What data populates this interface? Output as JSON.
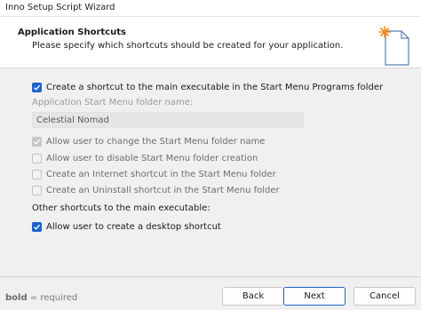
{
  "window": {
    "title": "Inno Setup Script Wizard"
  },
  "header": {
    "title": "Application Shortcuts",
    "subtitle": "Please specify which shortcuts should be created for your application.",
    "image_icon": "wizard-document-sparkle-icon"
  },
  "options": {
    "start_menu_shortcut": {
      "label": "Create a shortcut to the main executable in the Start Menu Programs folder",
      "checked": true
    },
    "folder_label": "Application Start Menu folder name:",
    "folder_value": "Celestial Nomad",
    "allow_change_folder": {
      "label": "Allow user to change the Start Menu folder name",
      "checked": true,
      "disabled": true
    },
    "allow_disable_folder": {
      "label": "Allow user to disable Start Menu folder creation",
      "checked": false,
      "disabled": true
    },
    "internet_shortcut": {
      "label": "Create an Internet shortcut in the Start Menu folder",
      "checked": false,
      "disabled": true
    },
    "uninstall_shortcut": {
      "label": "Create an Uninstall shortcut in the Start Menu folder",
      "checked": false,
      "disabled": true
    },
    "other_section_title": "Other shortcuts to the main executable:",
    "desktop_shortcut": {
      "label": "Allow user to create a desktop shortcut",
      "checked": true
    }
  },
  "footer": {
    "required_bold": "bold",
    "required_text": " = required",
    "back_label": "Back",
    "next_label": "Next",
    "cancel_label": "Cancel"
  },
  "colors": {
    "accent": "#1f63c9",
    "sparkle": "#f08a1c"
  }
}
